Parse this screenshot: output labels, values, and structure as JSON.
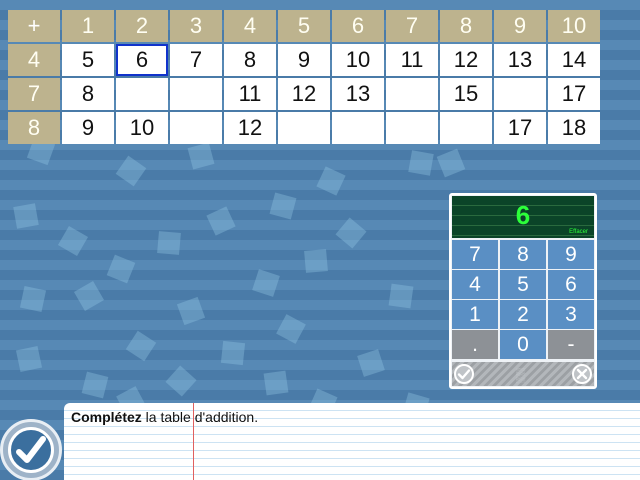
{
  "table": {
    "corner": "+",
    "column_headers": [
      "1",
      "2",
      "3",
      "4",
      "5",
      "6",
      "7",
      "8",
      "9",
      "10"
    ],
    "rows": [
      {
        "header": "4",
        "cells": [
          "5",
          "6",
          "7",
          "8",
          "9",
          "10",
          "11",
          "12",
          "13",
          "14"
        ]
      },
      {
        "header": "7",
        "cells": [
          "8",
          "",
          "",
          "11",
          "12",
          "13",
          "",
          "15",
          "",
          "17"
        ]
      },
      {
        "header": "8",
        "cells": [
          "9",
          "10",
          "",
          "12",
          "",
          "",
          "",
          "",
          "17",
          "18"
        ]
      }
    ],
    "selected": {
      "row": 0,
      "col": 1
    }
  },
  "keypad": {
    "display": "6",
    "erase_label": "Effacer",
    "keys": [
      [
        "7",
        "8",
        "9"
      ],
      [
        "4",
        "5",
        "6"
      ],
      [
        "1",
        "2",
        "3"
      ],
      [
        ".",
        "0",
        "-"
      ]
    ],
    "confirm_icon": "check-circle-icon",
    "cancel_icon": "close-circle-icon",
    "move_icon": "drag-handle-icon"
  },
  "instruction": {
    "bold": "Complétez",
    "rest": " la table d'addition."
  },
  "validate_icon": "checkmark-icon",
  "colors": {
    "header_bg": "#bdb38e",
    "selection_border": "#1133cc",
    "key_blue": "#5a8fc4",
    "display_green": "#2cff3a",
    "background_blue": "#4d7eab"
  }
}
